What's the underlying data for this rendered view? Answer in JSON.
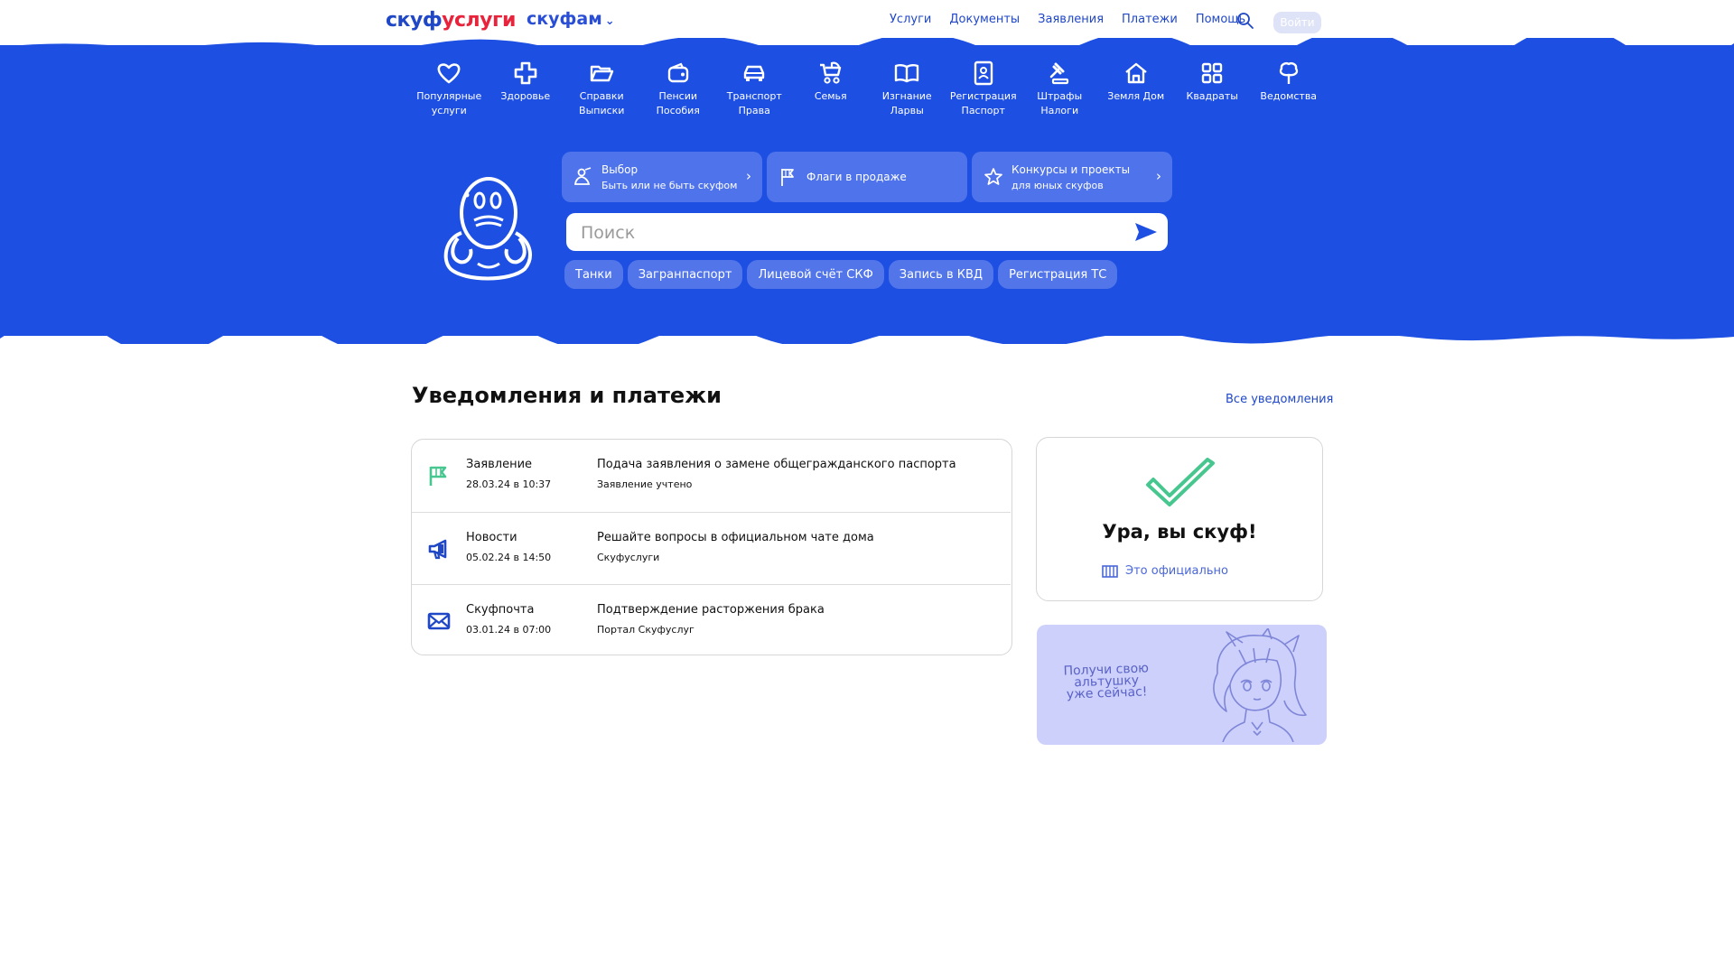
{
  "header": {
    "logo_part1": "скуф",
    "logo_part2": "услуги",
    "family_label": "скуфам",
    "nav": [
      "Услуги",
      "Документы",
      "Заявления",
      "Платежи",
      "Помощь"
    ],
    "login_label": "Войти"
  },
  "categories": [
    {
      "label": "Популярные\nуслуги",
      "icon": "heart-icon"
    },
    {
      "label": "Здоровье",
      "icon": "health-cross-icon"
    },
    {
      "label": "Справки\nВыписки",
      "icon": "folder-icon"
    },
    {
      "label": "Пенсии\nПособия",
      "icon": "wallet-icon"
    },
    {
      "label": "Транспорт\nПрава",
      "icon": "car-icon"
    },
    {
      "label": "Семья",
      "icon": "stroller-icon"
    },
    {
      "label": "Изгнание\nЛарвы",
      "icon": "book-icon"
    },
    {
      "label": "Регистрация\nПаспорт",
      "icon": "passport-icon"
    },
    {
      "label": "Штрафы\nНалоги",
      "icon": "gavel-icon"
    },
    {
      "label": "Земля Дом",
      "icon": "house-icon"
    },
    {
      "label": "Квадраты",
      "icon": "squares-icon"
    },
    {
      "label": "Ведомства",
      "icon": "building-tree-icon"
    }
  ],
  "quick_cards": [
    {
      "title": "Выбор",
      "subtitle": "Быть или не быть скуфом",
      "icon": "person-icon"
    },
    {
      "title": "Флаги в продаже",
      "subtitle": "",
      "icon": "flag-icon"
    },
    {
      "title": "Конкурсы и проекты",
      "subtitle": "для юных скуфов",
      "icon": "star-icon"
    }
  ],
  "search": {
    "placeholder": "Поиск"
  },
  "chips": [
    "Танки",
    "Загранпаспорт",
    "Лицевой счёт СКФ",
    "Запись в КВД",
    "Регистрация ТС"
  ],
  "notifications": {
    "title": "Уведомления и платежи",
    "all_link": "Все уведомления",
    "items": [
      {
        "type": "Заявление",
        "date": "28.03.24 в 10:37",
        "title": "Подача заявления о замене общегражданского паспорта",
        "subtitle": "Заявление учтено",
        "icon": "flag-icon",
        "color": "#47c78f"
      },
      {
        "type": "Новости",
        "date": "05.02.24 в 14:50",
        "title": "Решайте вопросы в официальном чате дома",
        "subtitle": "Скуфуслуги",
        "icon": "megaphone-icon",
        "color": "#1f47c6"
      },
      {
        "type": "Скуфпочта",
        "date": "03.01.24 в 07:00",
        "title": "Подтверждение расторжения брака",
        "subtitle": "Портал Скуфуслуг",
        "icon": "mail-icon",
        "color": "#1f47c6"
      }
    ]
  },
  "status_card": {
    "title": "Ура, вы скуф!",
    "link": "Это официально"
  },
  "promo": {
    "text_line1": "Получи свою",
    "text_line2": "альтушку",
    "text_line3": "уже сейчас!"
  },
  "colors": {
    "primary": "#1d4fe3",
    "accent_green": "#47c78f",
    "promo_bg": "#ccd0fb"
  }
}
